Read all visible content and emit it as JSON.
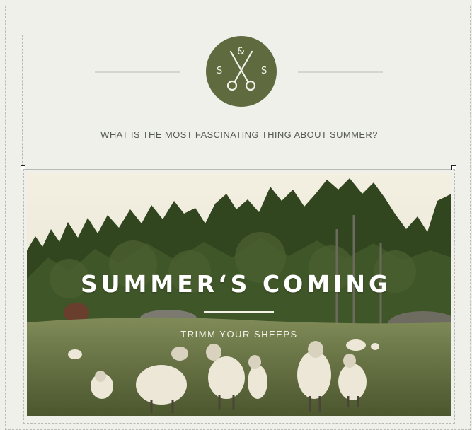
{
  "logo": {
    "ampersand": "&",
    "letter_left": "S",
    "letter_right": "S",
    "icon": "scissors-icon",
    "background": "#5f6b3f"
  },
  "header": {
    "question": "WHAT IS THE MOST FASCINATING THING ABOUT SUMMER?"
  },
  "hero": {
    "title": "SUMMER‘S COMING",
    "subtitle": "TRIMM YOUR SHEEPS",
    "image": "sheep-meadow-photo"
  },
  "colors": {
    "page_background": "#eef0e9",
    "accent": "#5f6b3f",
    "text": "#555a50"
  }
}
